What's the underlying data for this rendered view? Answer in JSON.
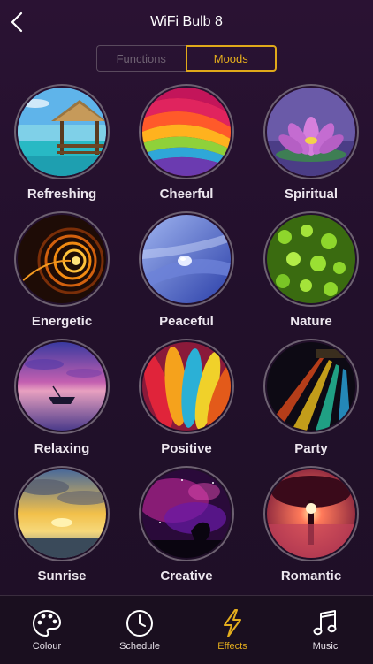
{
  "header": {
    "title": "WiFi Bulb 8",
    "back_icon": "chevron-left-icon"
  },
  "segments": {
    "functions_label": "Functions",
    "moods_label": "Moods",
    "selected": "Moods"
  },
  "moods": [
    {
      "label": "Refreshing",
      "icon": "beach-hut-photo"
    },
    {
      "label": "Cheerful",
      "icon": "rainbow-ribbons-photo"
    },
    {
      "label": "Spiritual",
      "icon": "lotus-flower-photo"
    },
    {
      "label": "Energetic",
      "icon": "light-spiral-photo"
    },
    {
      "label": "Peaceful",
      "icon": "water-droplet-photo"
    },
    {
      "label": "Nature",
      "icon": "green-leaves-photo"
    },
    {
      "label": "Relaxing",
      "icon": "boat-sunset-photo"
    },
    {
      "label": "Positive",
      "icon": "colorful-feathers-photo"
    },
    {
      "label": "Party",
      "icon": "stage-lights-photo"
    },
    {
      "label": "Sunrise",
      "icon": "sunrise-clouds-photo"
    },
    {
      "label": "Creative",
      "icon": "nebula-photo"
    },
    {
      "label": "Romantic",
      "icon": "tree-sunset-photo"
    }
  ],
  "tabs": [
    {
      "label": "Colour",
      "icon": "palette-icon"
    },
    {
      "label": "Schedule",
      "icon": "clock-icon"
    },
    {
      "label": "Effects",
      "icon": "lightning-icon",
      "active": true
    },
    {
      "label": "Music",
      "icon": "music-note-icon"
    }
  ],
  "colors": {
    "accent": "#e3ad1d",
    "background": "#22102b",
    "tabbar": "#1a0f1f"
  }
}
